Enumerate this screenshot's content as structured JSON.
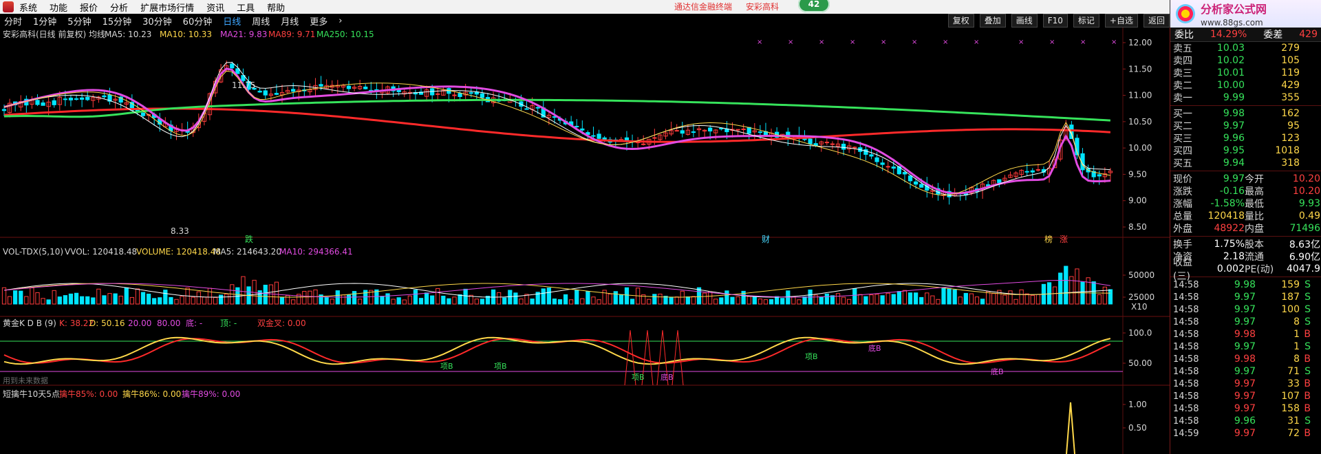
{
  "menubar": {
    "items": [
      "系统",
      "功能",
      "报价",
      "分析",
      "扩展市场行情",
      "资讯",
      "工具",
      "帮助"
    ],
    "center": [
      "通达信金融终端",
      "安彩高科"
    ],
    "badge": "42"
  },
  "logo": {
    "name": "分析家公式网",
    "url": "www.88gs.com"
  },
  "toolbar": {
    "timeframes": [
      "分时",
      "1分钟",
      "5分钟",
      "15分钟",
      "30分钟",
      "60分钟",
      "日线",
      "周线",
      "月线",
      "更多"
    ],
    "active": "日线",
    "buttons": [
      "复权",
      "叠加",
      "画线",
      "F10",
      "标记",
      "+自选",
      "返回"
    ]
  },
  "chart": {
    "title_line": {
      "security": "安彩高科(日线 前复权) 均线",
      "ma5": "MA5: 10.23",
      "ma10": "MA10: 10.33",
      "ma21": "MA21: 9.83",
      "ma89": "MA89: 9.71",
      "ma250": "MA250: 10.15"
    },
    "price_axis_labels": [
      "12.00",
      "11.50",
      "11.00",
      "10.50",
      "10.00",
      "9.50",
      "9.00",
      "8.50"
    ],
    "price_marks": {
      "high": "11.75",
      "low": "8.33"
    },
    "events": {
      "a": "跌",
      "b": "财",
      "c": "榜",
      "d": "涨"
    },
    "vol_title": {
      "label": "VOL-TDX(5,10)",
      "wvol": "VVOL: 120418.48",
      "volume": "VOLUME: 120418.48",
      "ma5": "MA5: 214643.20",
      "ma10": "MA10: 294366.41"
    },
    "vol_axis_labels": [
      "50000",
      "25000"
    ],
    "vol_unit": "X10",
    "kdb_title": {
      "label": "黄金K D B (9)",
      "k": "K: 38.22",
      "d": "D: 50.16",
      "zone1": "20.00",
      "zone2": "80.00",
      "bottom": "底: -",
      "top": "顶: -",
      "cross": "双金叉: 0.00"
    },
    "kdb_axis_labels": [
      "100.0",
      "50.00"
    ],
    "kdb_note": "用到未来数据",
    "kdb_markers": {
      "cross1": "项B",
      "cross2": "项B",
      "cross3": "项B",
      "cross4": "底B",
      "cross5": "底B",
      "cross6": "项B",
      "cross7": "底B"
    },
    "short_title": {
      "label": "短擒牛10天5点",
      "a": "擒牛85%: 0.00",
      "b": "擒牛86%: 0.00",
      "c": "擒牛89%: 0.00"
    },
    "short_axis_labels": [
      "1.00",
      "0.50"
    ]
  },
  "info_panel": {
    "top": {
      "a": "委比",
      "a_val": "14.29%",
      "b": "委差",
      "b_val": "429"
    },
    "asks": [
      {
        "k": "卖五",
        "p": "10.03",
        "v": "279"
      },
      {
        "k": "卖四",
        "p": "10.02",
        "v": "105"
      },
      {
        "k": "卖三",
        "p": "10.01",
        "v": "119"
      },
      {
        "k": "卖二",
        "p": "10.00",
        "v": "429"
      },
      {
        "k": "卖一",
        "p": "9.99",
        "v": "355"
      }
    ],
    "bids": [
      {
        "k": "买一",
        "p": "9.98",
        "v": "162"
      },
      {
        "k": "买二",
        "p": "9.97",
        "v": "95"
      },
      {
        "k": "买三",
        "p": "9.96",
        "v": "123"
      },
      {
        "k": "买四",
        "p": "9.95",
        "v": "1018"
      },
      {
        "k": "买五",
        "p": "9.94",
        "v": "318"
      }
    ],
    "stats": [
      {
        "k1": "现价",
        "v1": "9.97",
        "c1": "green",
        "k2": "今开",
        "v2": "10.20",
        "c2": "red"
      },
      {
        "k1": "涨跌",
        "v1": "-0.16",
        "c1": "green",
        "k2": "最高",
        "v2": "10.20",
        "c2": "red"
      },
      {
        "k1": "涨幅",
        "v1": "-1.58%",
        "c1": "green",
        "k2": "最低",
        "v2": "9.93",
        "c2": "green"
      },
      {
        "k1": "总量",
        "v1": "120418",
        "c1": "yellow",
        "k2": "量比",
        "v2": "0.49",
        "c2": "yellow"
      },
      {
        "k1": "外盘",
        "v1": "48922",
        "c1": "red",
        "k2": "内盘",
        "v2": "71496",
        "c2": "green"
      }
    ],
    "stats2": [
      {
        "k1": "换手",
        "v1": "1.75%",
        "k2": "股本",
        "v2": "8.63亿"
      },
      {
        "k1": "净资",
        "v1": "2.18",
        "k2": "流通",
        "v2": "6.90亿"
      },
      {
        "k1": "收益(三)",
        "v1": "0.002",
        "k2": "PE(动)",
        "v2": "4047.9"
      }
    ],
    "deals": [
      {
        "t": "14:58",
        "p": "9.98",
        "v": "159",
        "bs": "S"
      },
      {
        "t": "14:58",
        "p": "9.97",
        "v": "187",
        "bs": "S"
      },
      {
        "t": "14:58",
        "p": "9.97",
        "v": "100",
        "bs": "S"
      },
      {
        "t": "14:58",
        "p": "9.97",
        "v": "8",
        "bs": "S"
      },
      {
        "t": "14:58",
        "p": "9.98",
        "v": "1",
        "bs": "B"
      },
      {
        "t": "14:58",
        "p": "9.97",
        "v": "1",
        "bs": "S"
      },
      {
        "t": "14:58",
        "p": "9.98",
        "v": "8",
        "bs": "B"
      },
      {
        "t": "14:58",
        "p": "9.97",
        "v": "71",
        "bs": "S"
      },
      {
        "t": "14:58",
        "p": "9.97",
        "v": "33",
        "bs": "B"
      },
      {
        "t": "14:58",
        "p": "9.97",
        "v": "107",
        "bs": "B"
      },
      {
        "t": "14:58",
        "p": "9.97",
        "v": "158",
        "bs": "B"
      },
      {
        "t": "14:58",
        "p": "9.96",
        "v": "31",
        "bs": "S"
      },
      {
        "t": "14:59",
        "p": "9.97",
        "v": "72",
        "bs": "B"
      }
    ]
  }
}
